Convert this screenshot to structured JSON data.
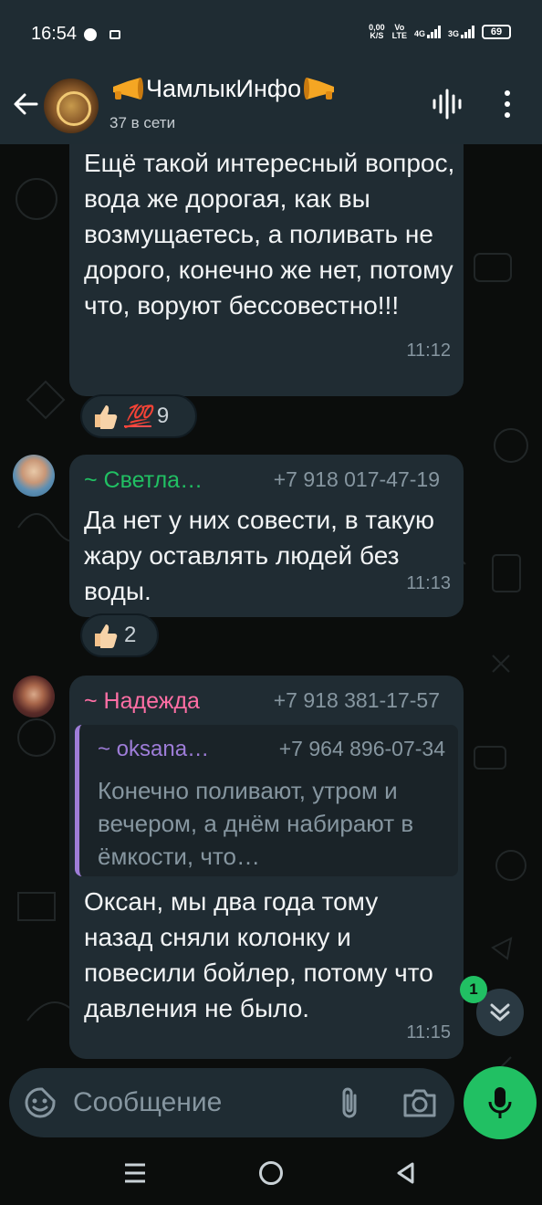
{
  "status_bar": {
    "time": "16:54",
    "net_speed_value": "0,00",
    "net_speed_unit": "K/S",
    "volte_top": "Vo",
    "volte_bottom": "LTE",
    "net_4g": "4G",
    "net_3g": "3G",
    "battery": "69"
  },
  "header": {
    "title": "ЧамлыкИнфо",
    "subtitle": "37 в сети"
  },
  "messages": [
    {
      "text": "Ещё такой интересный вопрос, вода же дорогая, как вы возмущаетесь, а поливать не дорого, конечно же нет, потому что, воруют бессовестно!!!",
      "time": "11:12",
      "reaction_emoji2": "💯",
      "reaction_count": "9"
    },
    {
      "sender": "~ Светла…",
      "phone": "+7 918 017-47-19",
      "text": "Да нет у них совести, в такую жару оставлять людей без воды.",
      "time": "11:13",
      "reaction_count": "2"
    },
    {
      "sender": "~ Надежда",
      "phone": "+7 918 381-17-57",
      "quote": {
        "sender": "~ oksana…",
        "phone": "+7 964 896-07-34",
        "text": "Конечно поливают, утром и вечером, а днём набирают в ёмкости, что…"
      },
      "text": "Оксан, мы два года тому назад сняли колонку и повесили бойлер, потому что давления не было.",
      "time": "11:15"
    }
  ],
  "scroll": {
    "unread_count": "1"
  },
  "composer": {
    "placeholder": "Сообщение"
  },
  "colors": {
    "accent_green": "#21c063",
    "sender_svetla": "#21c063",
    "sender_nadezhda": "#ff6fa5",
    "quote_accent": "#9e7dd8",
    "bubble": "#202c33"
  }
}
